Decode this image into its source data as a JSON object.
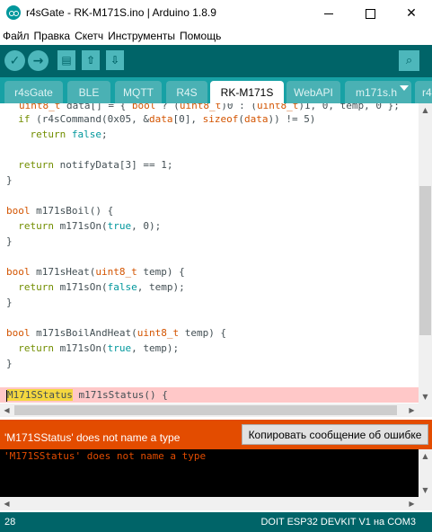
{
  "window": {
    "title": "r4sGate - RK-M171S.ino | Arduino 1.8.9",
    "close_glyph": "✕"
  },
  "menu": [
    "Файл",
    "Правка",
    "Скетч",
    "Инструменты",
    "Помощь"
  ],
  "toolbar": {
    "verify_glyph": "✓",
    "upload_glyph": "→",
    "new_glyph": "▤",
    "open_glyph": "⇧",
    "save_glyph": "⇩",
    "serial_glyph": "⌕"
  },
  "tabs": [
    "r4sGate",
    "BLE",
    "MQTT",
    "R4S",
    "RK-M171S",
    "WebAPI",
    "m171s.h",
    "r4"
  ],
  "active_tab": "RK-M171S",
  "editor": {
    "lines": [
      "uint8_t data[] = { bool ? (uint8_t)0 : (uint8_t)1, 0, temp, 0 };",
      "  if (r4sCommand(0x05, &data[0], sizeof(data)) != 5)",
      "    return false;",
      "",
      "  return notifyData[3] == 1;",
      "}",
      "",
      "bool m171sBoil() {",
      "  return m171sOn(true, 0);",
      "}",
      "",
      "bool m171sHeat(uint8_t temp) {",
      "  return m171sOn(false, temp);",
      "}",
      "",
      "bool m171sBoilAndHeat(uint8_t temp) {",
      "  return m171sOn(true, temp);",
      "}",
      "",
      "M171SStatus m171sStatus() {"
    ],
    "highlight_line": 20
  },
  "error": {
    "message": "'M171SStatus' does not name a type",
    "copy_button": "Копировать сообщение об ошибке"
  },
  "console": {
    "lines": [
      "'M171SStatus' does not name a type"
    ]
  },
  "status": {
    "line_number": "28",
    "board": "DOIT ESP32 DEVKIT V1 на COM3"
  },
  "colors": {
    "toolbar": "#006468",
    "tabbar": "#17a1a5",
    "error": "#e34c00",
    "highlight_line": "#ffc8c8",
    "highlight_ident": "#f4d73f"
  }
}
